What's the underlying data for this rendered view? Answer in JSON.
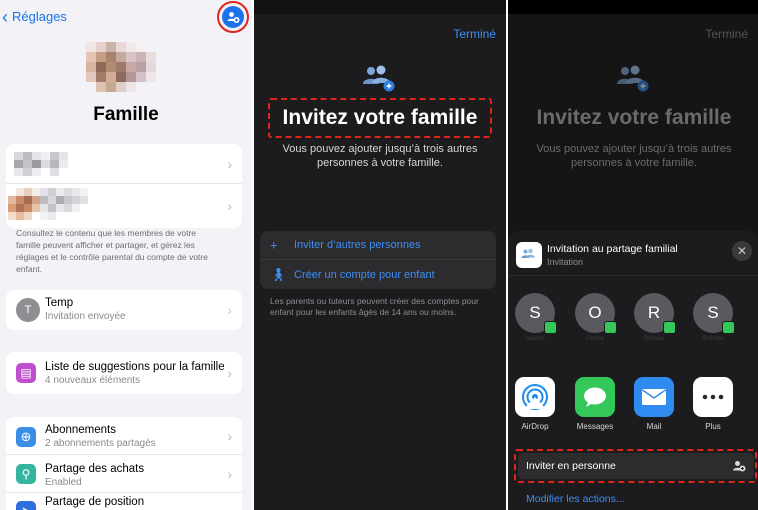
{
  "panel1": {
    "back_label": "Réglages",
    "title": "Famille",
    "note": "Consultez le contenu que les membres de votre famille peuvent afficher et partager, et gérez les réglages et le contrôle parental du compte de votre enfant.",
    "temp_row": {
      "avatar_letter": "T",
      "title": "Temp",
      "subtitle": "Invitation envoyée"
    },
    "suggestions_row": {
      "title": "Liste de suggestions pour la famille",
      "subtitle": "4 nouveaux éléments"
    },
    "subscriptions_row": {
      "title": "Abonnements",
      "subtitle": "2 abonnements partagés"
    },
    "purchases_row": {
      "title": "Partage des achats",
      "subtitle": "Enabled"
    },
    "location_row": {
      "title": "Partage de position"
    },
    "icons": [
      "add-family-member-icon",
      "suggestions-icon",
      "subscriptions-icon",
      "purchases-icon",
      "location-icon"
    ]
  },
  "panel2": {
    "done_label": "Terminé",
    "title": "Invitez votre famille",
    "subtitle": "Vous pouvez ajouter jusqu’à trois autres personnes à votre famille.",
    "options": [
      {
        "icon": "plus-icon",
        "label": "Inviter d’autres personnes"
      },
      {
        "icon": "child-icon",
        "label": "Créer un compte pour enfant"
      }
    ],
    "note": "Les parents ou tuteurs peuvent créer des comptes pour enfant pour les enfants âgés de 14 ans ou moins."
  },
  "panel3": {
    "done_label": "Terminé",
    "title": "Invitez votre famille",
    "subtitle": "Vous pouvez ajouter jusqu’à trois autres personnes à votre famille.",
    "sheet": {
      "title": "Invitation au partage familial",
      "subtitle": "Invitation",
      "close_glyph": "✕",
      "people": [
        {
          "letter": "S",
          "name": "sadrine"
        },
        {
          "letter": "O",
          "name": "Ourida"
        },
        {
          "letter": "R",
          "name": "Renske"
        },
        {
          "letter": "S",
          "name": "Sinkster"
        }
      ],
      "apps": [
        {
          "name": "AirDrop",
          "icon": "airdrop-icon"
        },
        {
          "name": "Messages",
          "icon": "messages-icon"
        },
        {
          "name": "Mail",
          "icon": "mail-icon"
        },
        {
          "name": "Plus",
          "icon": "more-icon"
        }
      ],
      "action_label": "Inviter en personne",
      "edit_actions": "Modifier les actions..."
    }
  },
  "colors": {
    "accent_blue": "#1a73e8",
    "dark_accent": "#3d8ef5",
    "highlight_red": "#e0241b",
    "messages_green": "#34c759"
  }
}
